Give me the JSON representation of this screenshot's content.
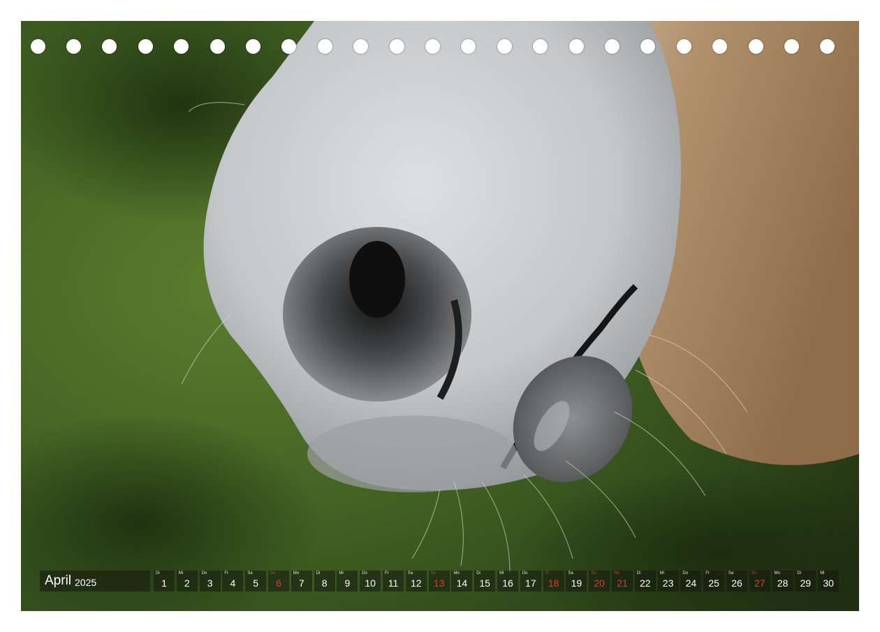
{
  "calendar": {
    "month": "April",
    "year": "2025",
    "days": [
      {
        "wd": "Di",
        "n": "1",
        "red": false
      },
      {
        "wd": "Mi",
        "n": "2",
        "red": false
      },
      {
        "wd": "Do",
        "n": "3",
        "red": false
      },
      {
        "wd": "Fr",
        "n": "4",
        "red": false
      },
      {
        "wd": "Sa",
        "n": "5",
        "red": false
      },
      {
        "wd": "So",
        "n": "6",
        "red": true
      },
      {
        "wd": "Mo",
        "n": "7",
        "red": false
      },
      {
        "wd": "Di",
        "n": "8",
        "red": false
      },
      {
        "wd": "Mi",
        "n": "9",
        "red": false
      },
      {
        "wd": "Do",
        "n": "10",
        "red": false
      },
      {
        "wd": "Fr",
        "n": "11",
        "red": false
      },
      {
        "wd": "Sa",
        "n": "12",
        "red": false
      },
      {
        "wd": "So",
        "n": "13",
        "red": true
      },
      {
        "wd": "Mo",
        "n": "14",
        "red": false
      },
      {
        "wd": "Di",
        "n": "15",
        "red": false
      },
      {
        "wd": "Mi",
        "n": "16",
        "red": false
      },
      {
        "wd": "Do",
        "n": "17",
        "red": false
      },
      {
        "wd": "Fr",
        "n": "18",
        "red": true
      },
      {
        "wd": "Sa",
        "n": "19",
        "red": false
      },
      {
        "wd": "So",
        "n": "20",
        "red": true
      },
      {
        "wd": "Mo",
        "n": "21",
        "red": true
      },
      {
        "wd": "Di",
        "n": "22",
        "red": false
      },
      {
        "wd": "Mi",
        "n": "23",
        "red": false
      },
      {
        "wd": "Do",
        "n": "24",
        "red": false
      },
      {
        "wd": "Fr",
        "n": "25",
        "red": false
      },
      {
        "wd": "Sa",
        "n": "26",
        "red": false
      },
      {
        "wd": "So",
        "n": "27",
        "red": true
      },
      {
        "wd": "Mo",
        "n": "28",
        "red": false
      },
      {
        "wd": "Di",
        "n": "29",
        "red": false
      },
      {
        "wd": "Mi",
        "n": "30",
        "red": false
      }
    ]
  },
  "binding_holes": 23,
  "colors": {
    "background_green": "#3d5a22",
    "muzzle_grey": "#c9cdd0",
    "coat_tan": "#b89a78",
    "holiday_red": "#e23a25"
  }
}
